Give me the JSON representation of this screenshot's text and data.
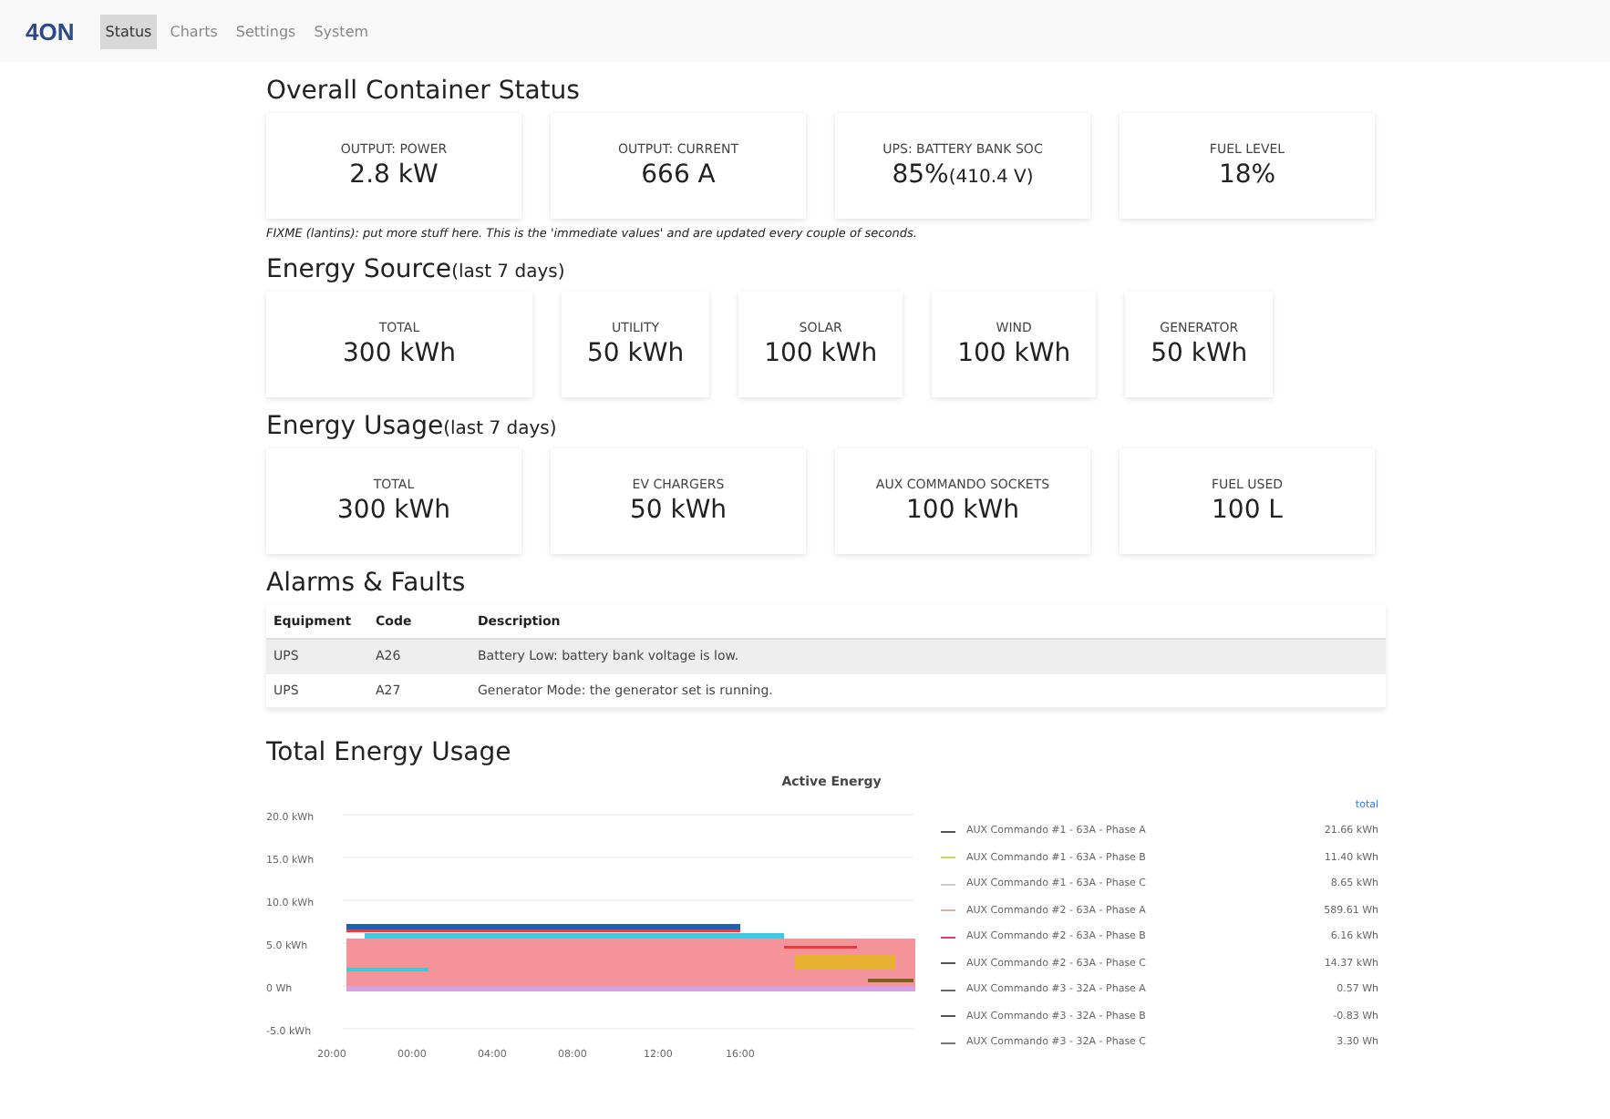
{
  "nav": {
    "brand": "4ON",
    "tabs": [
      {
        "label": "Status",
        "selected": true
      },
      {
        "label": "Charts",
        "selected": false
      },
      {
        "label": "Settings",
        "selected": false
      },
      {
        "label": "System",
        "selected": false
      }
    ]
  },
  "sections": [
    {
      "title": "Overall Container Status",
      "cards": [
        {
          "label": "OUTPUT: POWER",
          "value": "2.8 kW"
        },
        {
          "label": "OUTPUT: CURRENT",
          "value": "666 A"
        },
        {
          "label": "UPS: BATTERY BANK SOC",
          "value": "85%",
          "detail": "(410.4 V)"
        },
        {
          "label": "FUEL LEVEL",
          "value": "18%"
        }
      ],
      "note": "FIXME (lantins): put more stuff here. This is the 'immediate values' and are updated every couple of seconds."
    },
    {
      "title": "Energy Source",
      "subtitle": "(last 7 days)",
      "cards": [
        {
          "label": "TOTAL",
          "value": "300 kWh"
        },
        {
          "label": "UTILITY",
          "value": "50 kWh"
        },
        {
          "label": "SOLAR",
          "value": "100 kWh"
        },
        {
          "label": "WIND",
          "value": "100 kWh"
        },
        {
          "label": "GENERATOR",
          "value": "50 kWh"
        }
      ]
    },
    {
      "title": "Energy Usage",
      "subtitle": "(last 7 days)",
      "cards": [
        {
          "label": "TOTAL",
          "value": "300 kWh"
        },
        {
          "label": "EV CHARGERS",
          "value": "50 kWh"
        },
        {
          "label": "AUX COMMANDO SOCKETS",
          "value": "100 kWh"
        },
        {
          "label": "FUEL USED",
          "value": "100 L"
        }
      ]
    }
  ],
  "alarms": {
    "title": "Alarms & Faults",
    "columns": [
      "Equipment",
      "Code",
      "Description"
    ],
    "rows": [
      [
        "UPS",
        "A26",
        "Battery Low: battery bank voltage is low."
      ],
      [
        "UPS",
        "A27",
        "Generator Mode: the generator set is running."
      ]
    ]
  },
  "energy": {
    "title": "Total Energy Usage",
    "chart_title": "Active Energy",
    "y_tick_labels": [
      "20.0 kWh",
      "15.0 kWh",
      "10.0 kWh",
      "5.0 kWh",
      "0 Wh",
      "-5.0 kWh"
    ],
    "x_tick_labels": [
      "20:00",
      "00:00",
      "04:00",
      "08:00",
      "12:00",
      "16:00"
    ],
    "legend_header": "total",
    "legend": [
      {
        "name": "AUX Commando #1 - 63A - Phase A",
        "total": "21.66 kWh",
        "color": "#555555"
      },
      {
        "name": "AUX Commando #1 - 63A - Phase B",
        "total": "11.40 kWh",
        "color": "#c8d86a"
      },
      {
        "name": "AUX Commando #1 - 63A - Phase C",
        "total": "8.65 kWh",
        "color": "#cccccc"
      },
      {
        "name": "AUX Commando #2 - 63A - Phase A",
        "total": "589.61 Wh",
        "color": "#f4a0a8"
      },
      {
        "name": "AUX Commando #2 - 63A - Phase B",
        "total": "6.16 kWh",
        "color": "#d04060"
      },
      {
        "name": "AUX Commando #2 - 63A - Phase C",
        "total": "14.37 kWh",
        "color": "#555555"
      },
      {
        "name": "AUX Commando #3 - 32A - Phase A",
        "total": "0.57 Wh",
        "color": "#666666"
      },
      {
        "name": "AUX Commando #3 - 32A - Phase B",
        "total": "-0.83 Wh",
        "color": "#555555"
      },
      {
        "name": "AUX Commando #3 - 32A - Phase C",
        "total": "3.30 Wh",
        "color": "#777777"
      }
    ]
  }
}
